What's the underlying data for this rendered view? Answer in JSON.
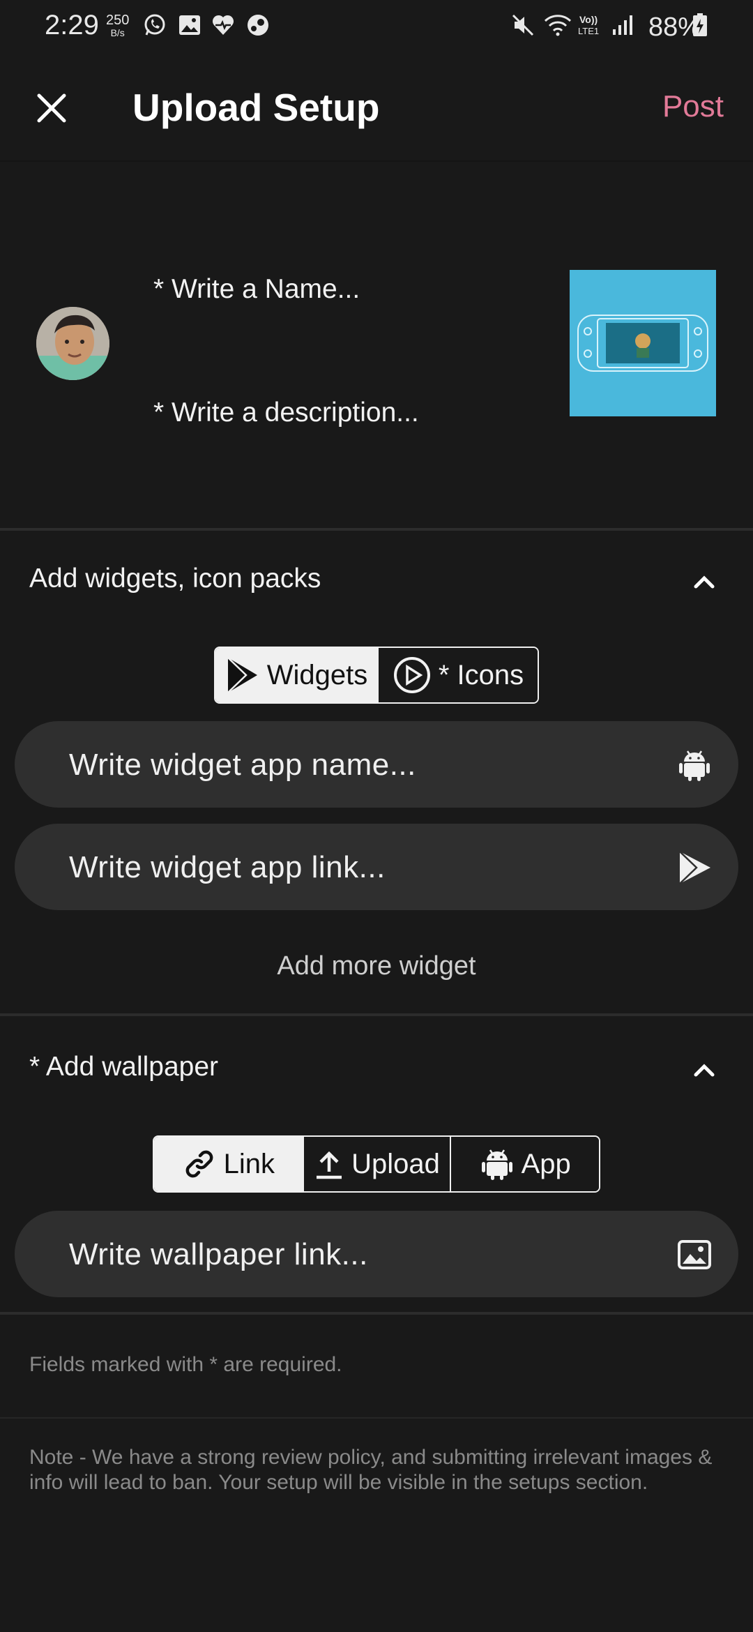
{
  "status_bar": {
    "time": "2:29",
    "speed_value": "250",
    "speed_unit": "B/s",
    "battery": "88%",
    "icons": [
      "whatsapp-icon",
      "gallery-icon",
      "health-icon",
      "steam-icon",
      "mute-icon",
      "wifi-icon",
      "volte-icon",
      "signal-icon",
      "battery-charging-icon"
    ]
  },
  "header": {
    "title": "Upload Setup",
    "post_label": "Post"
  },
  "profile": {
    "name_placeholder": "* Write a Name...",
    "description_placeholder": "* Write a description..."
  },
  "widgets_section": {
    "title": "Add widgets, icon packs",
    "tabs": [
      {
        "label": "Widgets",
        "active": true,
        "icon": "play-store-icon"
      },
      {
        "label": "* Icons",
        "active": false,
        "icon": "play-circle-icon"
      }
    ],
    "app_name_placeholder": "Write widget app name...",
    "app_link_placeholder": "Write widget app link...",
    "add_more_label": "Add more widget"
  },
  "wallpaper_section": {
    "title": "* Add wallpaper",
    "tabs": [
      {
        "label": "Link",
        "active": true,
        "icon": "link-icon"
      },
      {
        "label": "Upload",
        "active": false,
        "icon": "upload-icon"
      },
      {
        "label": "App",
        "active": false,
        "icon": "android-icon"
      }
    ],
    "link_placeholder": "Write wallpaper link..."
  },
  "footer": {
    "required_note": "Fields marked with * are required.",
    "policy_note": "Note - We have a strong review policy, and submitting irrelevant images & info will lead to ban. Your setup will be visible in the setups section."
  },
  "colors": {
    "background": "#191919",
    "accent_post": "#e27a98",
    "input_bg": "#2f2f2f",
    "thumbnail_bg": "#4ab8dc"
  }
}
